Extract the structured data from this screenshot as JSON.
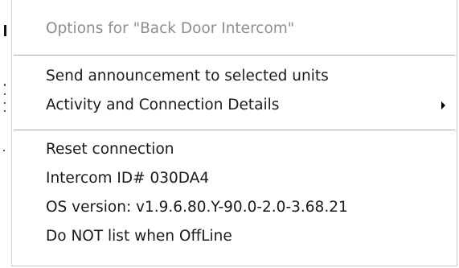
{
  "menu": {
    "header": "Options for \"Back Door Intercom\"",
    "group1": [
      {
        "label": "Send announcement to selected units"
      },
      {
        "label": "Activity and Connection Details",
        "icon": "submenu-arrow-icon"
      }
    ],
    "group2": [
      {
        "label": "Reset connection"
      },
      {
        "label": "Intercom ID# 030DA4"
      },
      {
        "label": "OS version: v1.9.6.80.Y-90.0-2.0-3.68.21"
      },
      {
        "label": "Do NOT list when OffLine"
      }
    ]
  },
  "colors": {
    "header_text": "#8e8e8e",
    "item_text": "#1a1a1a",
    "separator": "#a8a8a8",
    "background": "#ffffff"
  }
}
